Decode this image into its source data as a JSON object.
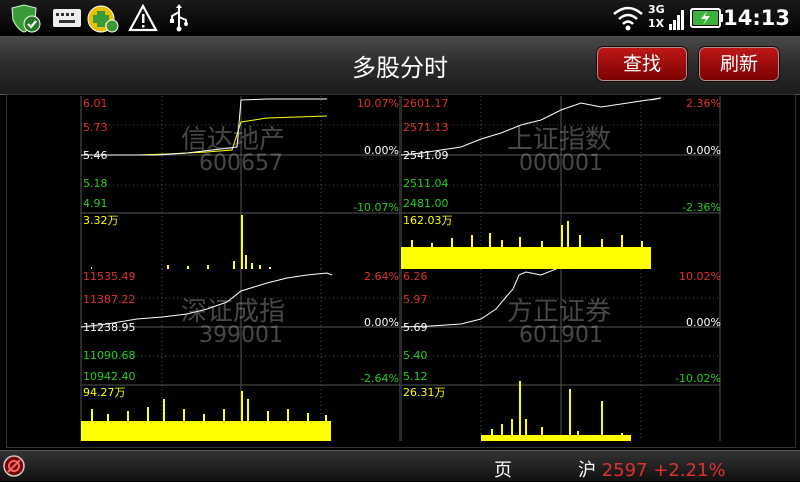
{
  "status": {
    "time": "14:13",
    "network": "3G",
    "network2": "1X"
  },
  "title": "多股分时",
  "buttons": {
    "search": "查找",
    "refresh": "刷新"
  },
  "panels": [
    {
      "name": "信达地产",
      "code": "600657",
      "labels": {
        "p_high": "6.01",
        "p_mid_high": "5.73",
        "p_base": "5.46",
        "p_mid_low": "5.18",
        "p_low": "4.91",
        "pct_high": "10.07%",
        "pct_base": "0.00%",
        "pct_low": "-10.07%",
        "volume": "3.32万"
      }
    },
    {
      "name": "上证指数",
      "code": "000001",
      "labels": {
        "p_high": "2601.17",
        "p_mid_high": "2571.13",
        "p_base": "2541.09",
        "p_mid_low": "2511.04",
        "p_low": "2481.00",
        "pct_high": "2.36%",
        "pct_base": "0.00%",
        "pct_low": "-2.36%",
        "volume": "162.03万"
      }
    },
    {
      "name": "深证成指",
      "code": "399001",
      "labels": {
        "p_high": "11535.49",
        "p_mid_high": "11387.22",
        "p_base": "11238.95",
        "p_mid_low": "11090.68",
        "p_low": "10942.40",
        "pct_high": "2.64%",
        "pct_base": "0.00%",
        "pct_low": "-2.64%",
        "volume": "94.27万"
      }
    },
    {
      "name": "方正证券",
      "code": "601901",
      "labels": {
        "p_high": "6.26",
        "p_mid_high": "5.97",
        "p_base": "5.69",
        "p_mid_low": "5.40",
        "p_low": "5.12",
        "pct_high": "10.02%",
        "pct_base": "0.00%",
        "pct_low": "-10.02%",
        "volume": "26.31万"
      }
    }
  ],
  "ticker": {
    "partial": "页",
    "market": "沪",
    "value": "2597",
    "change": "+2.21%"
  },
  "colors": {
    "up": "#e03030",
    "down": "#22cc22",
    "volume": "#ffff00",
    "price_line": "#ffffff",
    "avg_line": "#ffff00"
  }
}
